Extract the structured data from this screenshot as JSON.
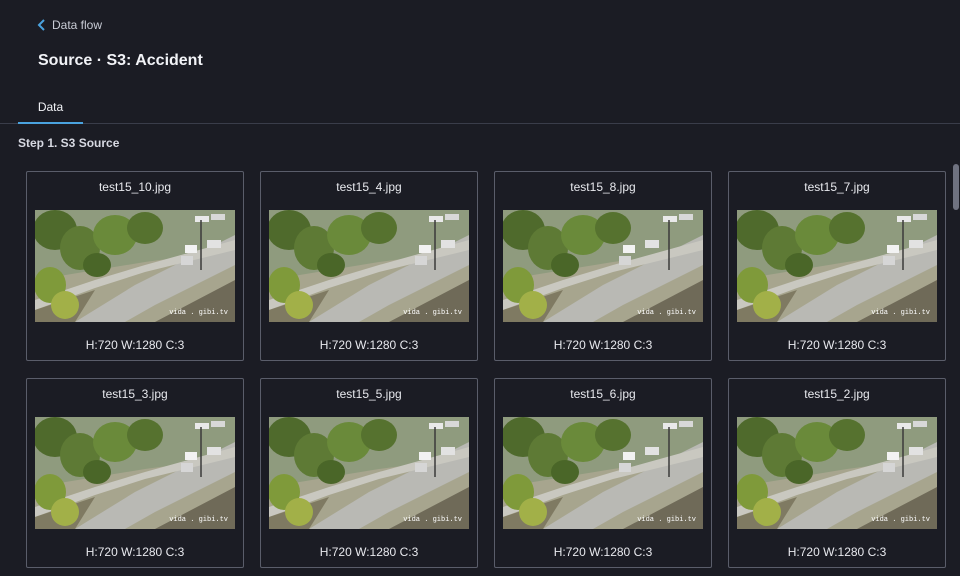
{
  "breadcrumb": {
    "back_label": "Data flow"
  },
  "page": {
    "title": "Source · S3: Accident"
  },
  "tabs": [
    {
      "label": "Data"
    }
  ],
  "step": {
    "label": "Step 1. S3 Source"
  },
  "images": [
    {
      "name": "test15_10.jpg",
      "meta": "H:720 W:1280 C:3",
      "car_pos": "right"
    },
    {
      "name": "test15_4.jpg",
      "meta": "H:720 W:1280 C:3",
      "car_pos": "right"
    },
    {
      "name": "test15_8.jpg",
      "meta": "H:720 W:1280 C:3",
      "car_pos": "center-right"
    },
    {
      "name": "test15_7.jpg",
      "meta": "H:720 W:1280 C:3",
      "car_pos": "right"
    },
    {
      "name": "test15_3.jpg",
      "meta": "H:720 W:1280 C:3",
      "car_pos": "right"
    },
    {
      "name": "test15_5.jpg",
      "meta": "H:720 W:1280 C:3",
      "car_pos": "right"
    },
    {
      "name": "test15_6.jpg",
      "meta": "H:720 W:1280 C:3",
      "car_pos": "center-right"
    },
    {
      "name": "test15_2.jpg",
      "meta": "H:720 W:1280 C:3",
      "car_pos": "right"
    }
  ],
  "watermark": "vida . gibi.tv",
  "colors": {
    "background": "#1b1c24",
    "accent": "#4aa3df",
    "card_border": "#5a5d6a"
  }
}
